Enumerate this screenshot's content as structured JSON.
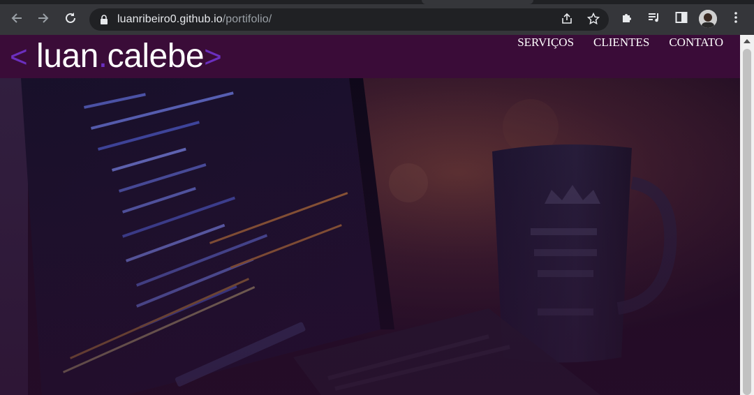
{
  "browser": {
    "url_domain": "luanribeiro0.github.io",
    "url_path": "/portifolio/",
    "back_icon": "arrow-left-icon",
    "forward_icon": "arrow-right-icon",
    "reload_icon": "reload-icon",
    "share_icon": "share-icon",
    "bookmark_icon": "star-icon",
    "extensions_icon": "puzzle-icon",
    "media_icon": "media-queue-icon",
    "sidepanel_icon": "side-panel-icon",
    "menu_icon": "kebab-menu-icon"
  },
  "site": {
    "logo": {
      "open_bracket": "<",
      "first": "luan",
      "dot": ".",
      "last": "calebe",
      "close_bracket": ">"
    },
    "nav": [
      {
        "label": "SERVIÇOS"
      },
      {
        "label": "CLIENTES"
      },
      {
        "label": "CONTATO"
      }
    ]
  },
  "colors": {
    "header_bg": "#3a0c38",
    "logo_accent": "#6b2fbf",
    "chrome_bg": "#35363a"
  }
}
